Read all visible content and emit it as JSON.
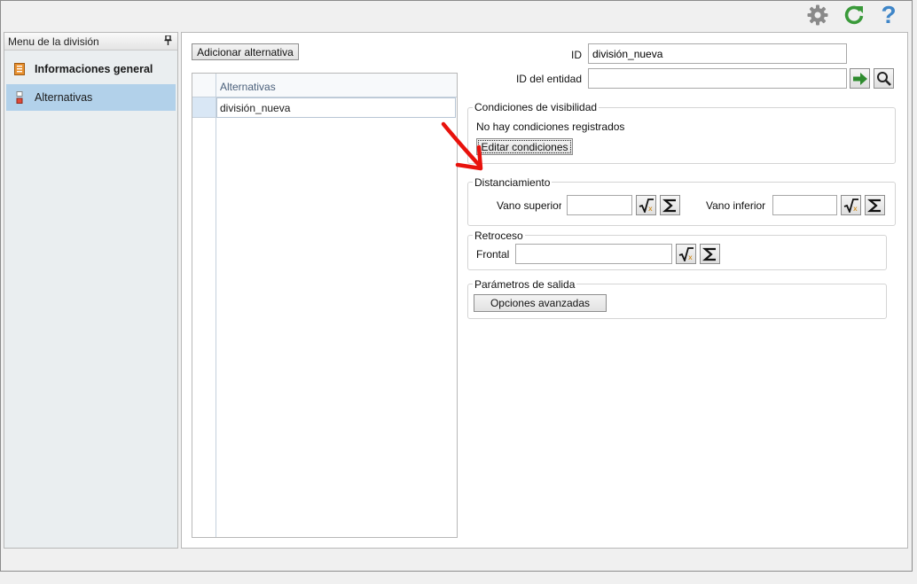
{
  "toolbar": {
    "icons": [
      "gear-icon",
      "refresh-icon",
      "help-icon"
    ],
    "help_glyph": "?"
  },
  "left_panel": {
    "title": "Menu de la división",
    "pin_glyph": "†",
    "items": [
      {
        "label": "Informaciones general",
        "icon": "info-page-icon",
        "selected": false,
        "bold": true
      },
      {
        "label": "Alternativas",
        "icon": "alternatives-icon",
        "selected": true,
        "bold": false
      }
    ]
  },
  "main": {
    "add_button_label": "Adicionar alternativa",
    "grid": {
      "header": "Alternativas",
      "rows": [
        "división_nueva"
      ]
    },
    "id_label": "ID",
    "id_value": "división_nueva",
    "entity_label": "ID del entidad",
    "entity_value": "",
    "visibility": {
      "title": "Condiciones de visibilidad",
      "status": "No hay condiciones registrados",
      "edit_button": "Editar condiciones"
    },
    "spacing": {
      "title": "Distanciamiento",
      "upper_label": "Vano superior",
      "upper_value": "",
      "lower_label": "Vano inferior",
      "lower_value": ""
    },
    "setback": {
      "title": "Retroceso",
      "front_label": "Frontal",
      "front_value": ""
    },
    "output": {
      "title": "Parámetros de salida",
      "advanced_button": "Opciones avanzadas"
    }
  },
  "colors": {
    "selection": "#b2d1ea",
    "arrow_annotation": "#e8120c",
    "go_arrow": "#2e8b2e",
    "refresh": "#3a9a3a",
    "help": "#3f86c8",
    "gear": "#8a8a8a"
  }
}
